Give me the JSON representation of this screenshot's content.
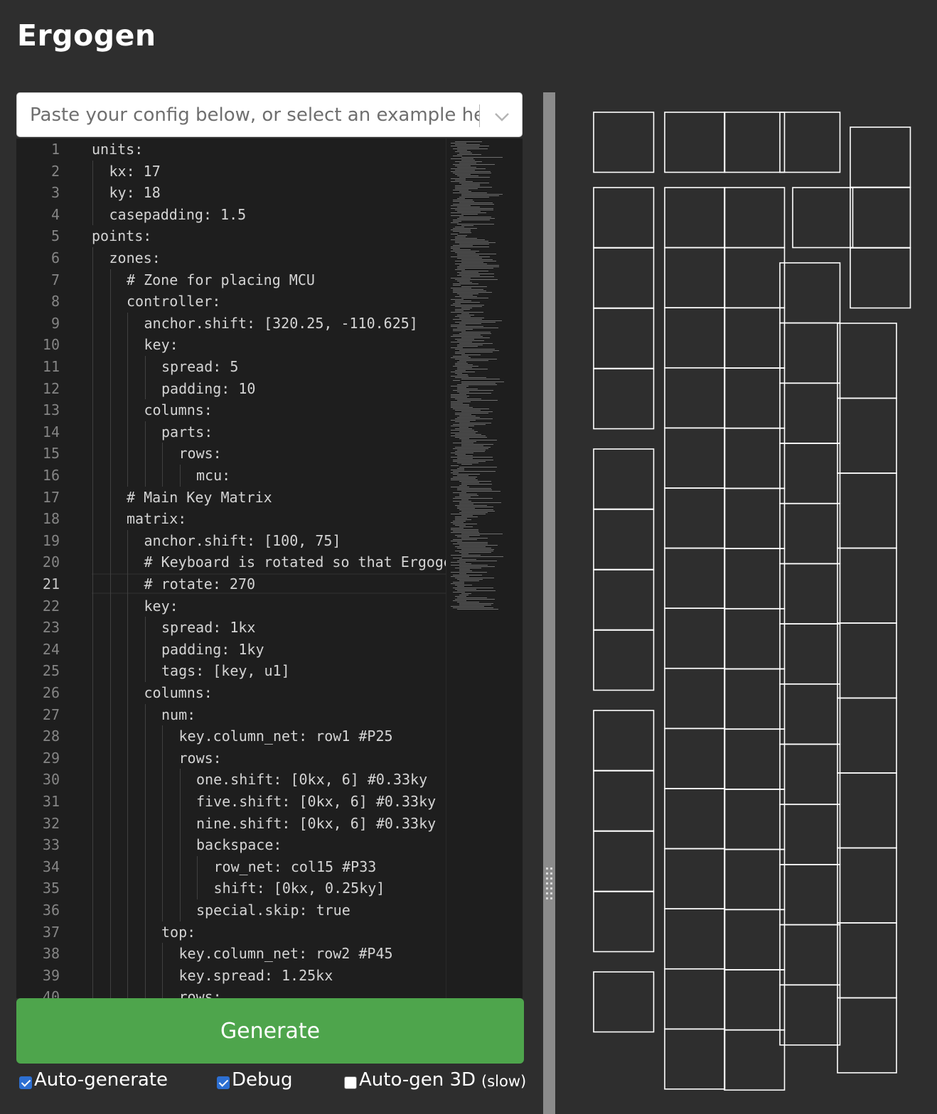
{
  "app": {
    "title": "Ergogen"
  },
  "example_select": {
    "placeholder": "Paste your config below, or select an example here!"
  },
  "editor": {
    "active_line": 21,
    "lines": [
      {
        "n": "1",
        "indent": 0,
        "text": "units:"
      },
      {
        "n": "2",
        "indent": 1,
        "text": "kx: 17"
      },
      {
        "n": "3",
        "indent": 1,
        "text": "ky: 18"
      },
      {
        "n": "4",
        "indent": 1,
        "text": "casepadding: 1.5"
      },
      {
        "n": "5",
        "indent": 0,
        "text": "points:"
      },
      {
        "n": "6",
        "indent": 1,
        "text": "zones:"
      },
      {
        "n": "7",
        "indent": 2,
        "text": "# Zone for placing MCU"
      },
      {
        "n": "8",
        "indent": 2,
        "text": "controller:"
      },
      {
        "n": "9",
        "indent": 3,
        "text": "anchor.shift: [320.25, -110.625]"
      },
      {
        "n": "10",
        "indent": 3,
        "text": "key:"
      },
      {
        "n": "11",
        "indent": 4,
        "text": "spread: 5"
      },
      {
        "n": "12",
        "indent": 4,
        "text": "padding: 10"
      },
      {
        "n": "13",
        "indent": 3,
        "text": "columns:"
      },
      {
        "n": "14",
        "indent": 4,
        "text": "parts:"
      },
      {
        "n": "15",
        "indent": 5,
        "text": "rows:"
      },
      {
        "n": "16",
        "indent": 6,
        "text": "mcu:"
      },
      {
        "n": "17",
        "indent": 2,
        "text": "# Main Key Matrix"
      },
      {
        "n": "18",
        "indent": 2,
        "text": "matrix:"
      },
      {
        "n": "19",
        "indent": 3,
        "text": "anchor.shift: [100, 75]"
      },
      {
        "n": "20",
        "indent": 3,
        "text": "# Keyboard is rotated so that Ergogen's"
      },
      {
        "n": "21",
        "indent": 3,
        "text": "# rotate: 270"
      },
      {
        "n": "22",
        "indent": 3,
        "text": "key:"
      },
      {
        "n": "23",
        "indent": 4,
        "text": "spread: 1kx"
      },
      {
        "n": "24",
        "indent": 4,
        "text": "padding: 1ky"
      },
      {
        "n": "25",
        "indent": 4,
        "text": "tags: [key, u1]"
      },
      {
        "n": "26",
        "indent": 3,
        "text": "columns:"
      },
      {
        "n": "27",
        "indent": 4,
        "text": "num:"
      },
      {
        "n": "28",
        "indent": 5,
        "text": "key.column_net: row1 #P25"
      },
      {
        "n": "29",
        "indent": 5,
        "text": "rows:"
      },
      {
        "n": "30",
        "indent": 6,
        "text": "one.shift: [0kx, 6] #0.33ky"
      },
      {
        "n": "31",
        "indent": 6,
        "text": "five.shift: [0kx, 6] #0.33ky"
      },
      {
        "n": "32",
        "indent": 6,
        "text": "nine.shift: [0kx, 6] #0.33ky"
      },
      {
        "n": "33",
        "indent": 6,
        "text": "backspace:"
      },
      {
        "n": "34",
        "indent": 7,
        "text": "row_net: col15 #P33"
      },
      {
        "n": "35",
        "indent": 7,
        "text": "shift: [0kx, 0.25ky]"
      },
      {
        "n": "36",
        "indent": 6,
        "text": "special.skip: true"
      },
      {
        "n": "37",
        "indent": 4,
        "text": "top:"
      },
      {
        "n": "38",
        "indent": 5,
        "text": "key.column_net: row2 #P45"
      },
      {
        "n": "39",
        "indent": 5,
        "text": "key.spread: 1.25kx"
      },
      {
        "n": "40",
        "indent": 5,
        "text": "rows:"
      }
    ]
  },
  "actions": {
    "generate_label": "Generate",
    "auto_generate_label": "Auto-generate",
    "auto_generate_checked": true,
    "debug_label": "Debug",
    "debug_checked": true,
    "auto_gen_3d_label": "Auto-gen 3D",
    "auto_gen_3d_note": "(slow)",
    "auto_gen_3d_checked": false
  },
  "colors": {
    "page_bg": "#2e2e2e",
    "editor_bg": "#1e1e1e",
    "generate_bg": "#4ea54c",
    "checkbox_on": "#2d6fd2",
    "key_outline": "#ffffff",
    "splitter": "#8b8b8b"
  },
  "icons": {
    "select_chevron": "chevron-down-icon",
    "splitter_grip": "grip-dots-icon"
  }
}
